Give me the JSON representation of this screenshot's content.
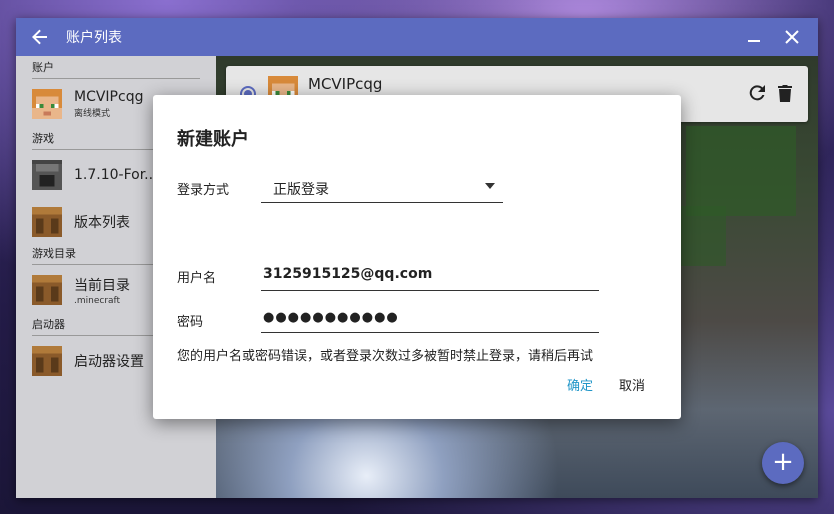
{
  "window": {
    "title": "账户列表"
  },
  "sidebar": {
    "sections": [
      {
        "label": "账户"
      },
      {
        "label": "游戏"
      },
      {
        "label": "游戏目录"
      },
      {
        "label": "启动器"
      }
    ],
    "items": [
      {
        "title": "MCVIPcqg",
        "subtitle": "离线模式",
        "icon": "steve-avatar-icon"
      },
      {
        "title": "1.7.10-For...",
        "subtitle": "",
        "icon": "furnace-block-icon"
      },
      {
        "title": "版本列表",
        "subtitle": "",
        "icon": "crafting-table-icon"
      },
      {
        "title": "当前目录",
        "subtitle": ".minecraft",
        "icon": "crafting-table-icon"
      },
      {
        "title": "启动器设置",
        "subtitle": "",
        "icon": "crafting-table-icon"
      }
    ]
  },
  "account_card": {
    "name": "MCVIPcqg",
    "selected": true
  },
  "dialog": {
    "title": "新建账户",
    "login_method_label": "登录方式",
    "login_method_value": "正版登录",
    "username_label": "用户名",
    "username_value": "3125915125@qq.com",
    "password_label": "密码",
    "password_value": "●●●●●●●●●●●",
    "error_message": "您的用户名或密码错误，或者登录次数过多被暂时禁止登录，请稍后再试",
    "ok_label": "确定",
    "cancel_label": "取消"
  },
  "colors": {
    "accent": "#5c6bc0",
    "link": "#2196c8"
  },
  "fab": {
    "label": "+"
  }
}
